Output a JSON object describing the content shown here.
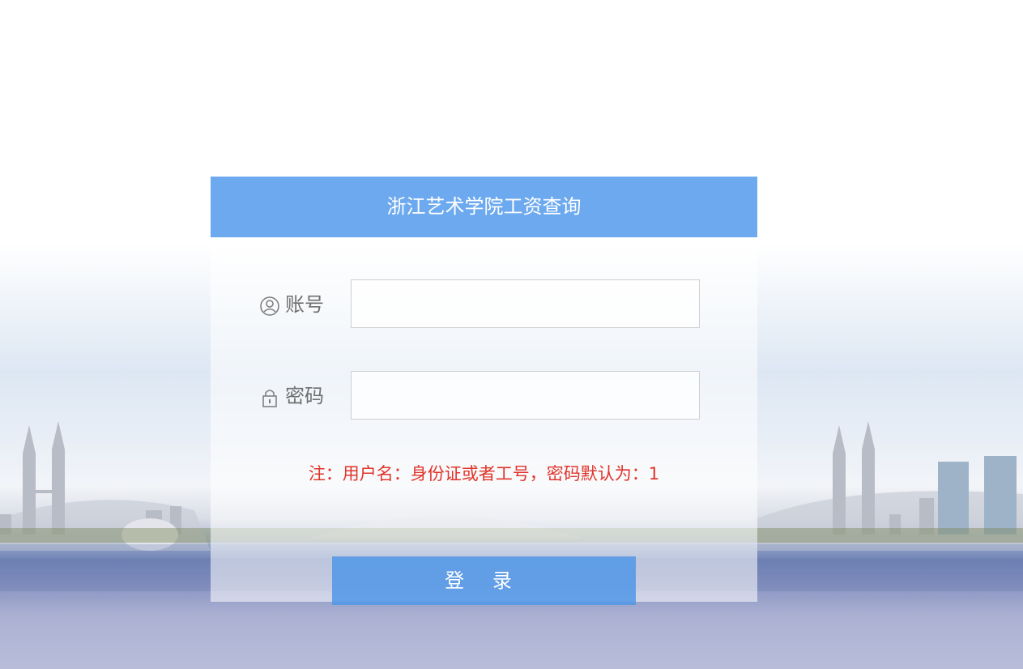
{
  "header": {
    "title": "浙江艺术学院工资查询"
  },
  "form": {
    "account_label": "账号",
    "account_icon": "user-circle-icon",
    "account_value": "",
    "password_label": "密码",
    "password_icon": "lock-icon",
    "password_value": "",
    "note": "注：用户名：身份证或者工号，密码默认为：1",
    "login_label": "登 录"
  },
  "colors": {
    "title_bar": "#6ca9ef",
    "note_text": "#e0352b",
    "login_button": "#5096e6"
  }
}
